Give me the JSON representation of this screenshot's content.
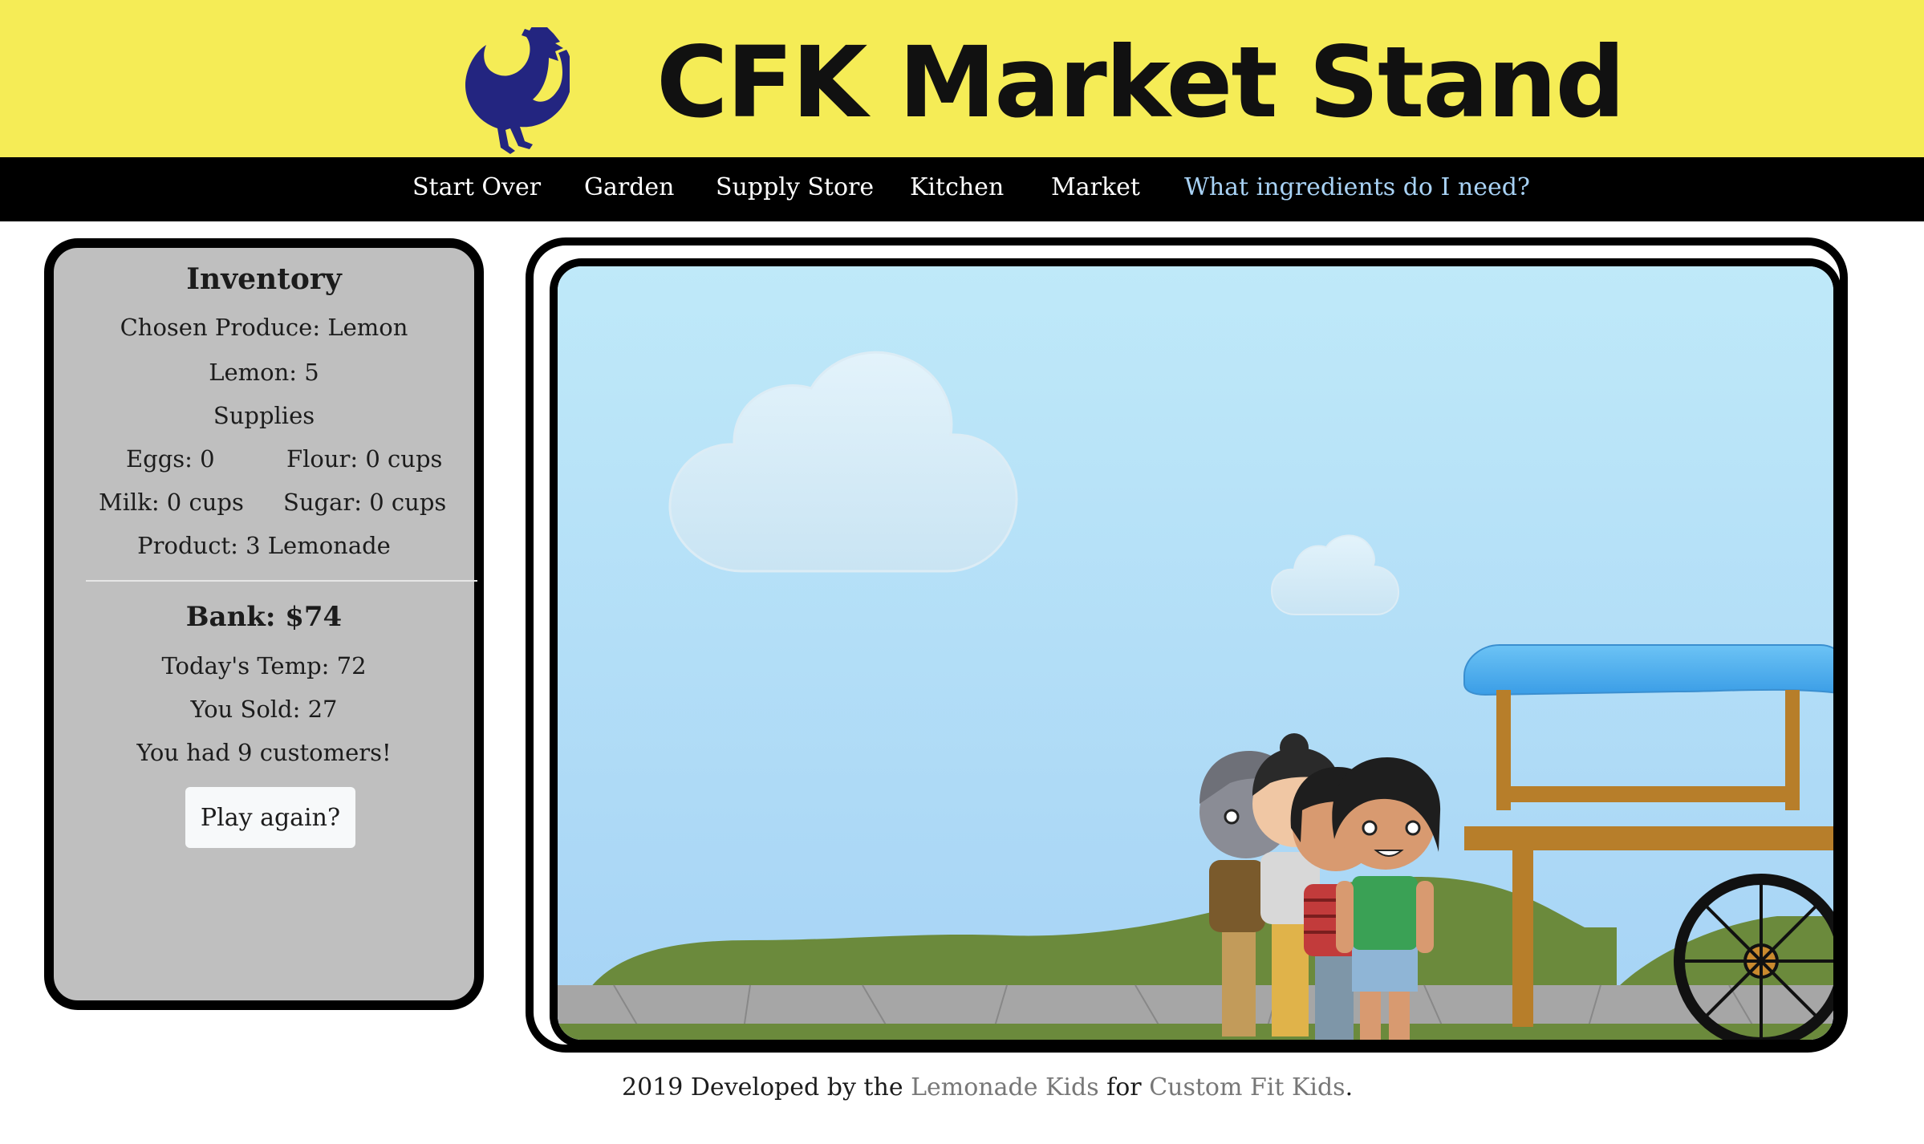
{
  "header": {
    "title": "CFK Market Stand",
    "logo": "rooster-logo"
  },
  "nav": {
    "items": [
      {
        "label": "Start Over"
      },
      {
        "label": "Garden"
      },
      {
        "label": "Supply Store"
      },
      {
        "label": "Kitchen"
      },
      {
        "label": "Market"
      },
      {
        "label": "What ingredients do I need?"
      }
    ]
  },
  "inventory": {
    "title": "Inventory",
    "chosen_produce": "Chosen Produce: Lemon",
    "produce_count": "Lemon: 5",
    "supplies_label": "Supplies",
    "eggs": "Eggs: 0",
    "flour": "Flour: 0 cups",
    "milk": "Milk: 0 cups",
    "sugar": "Sugar: 0 cups",
    "product": "Product: 3 Lemonade",
    "bank": "Bank: $74",
    "temp": "Today's Temp: 72",
    "sold": "You Sold: 27",
    "customers": "You had 9 customers!",
    "play_again": "Play again?"
  },
  "scene": {
    "elements": [
      "cloud",
      "cloud",
      "hills",
      "sidewalk",
      "lemonade-cart",
      "customers-line"
    ],
    "colors": {
      "sky_top": "#bfe9f9",
      "sky_bottom": "#a6d3f5",
      "hills": "#6b8a3c",
      "sidewalk": "#a6a6a6",
      "awning": "#4fb0ef",
      "cart_wood": "#b77e2a"
    }
  },
  "footer": {
    "prefix": "2019 Developed by the ",
    "team_link": "Lemonade Kids",
    "middle": " for ",
    "org_link": "Custom Fit Kids",
    "suffix": "."
  },
  "colors": {
    "header_bg": "#f5ec56",
    "nav_bg": "#000000",
    "nav_help_link": "#a8d2f5",
    "panel_bg": "#bfbfbf",
    "logo": "#232580"
  }
}
